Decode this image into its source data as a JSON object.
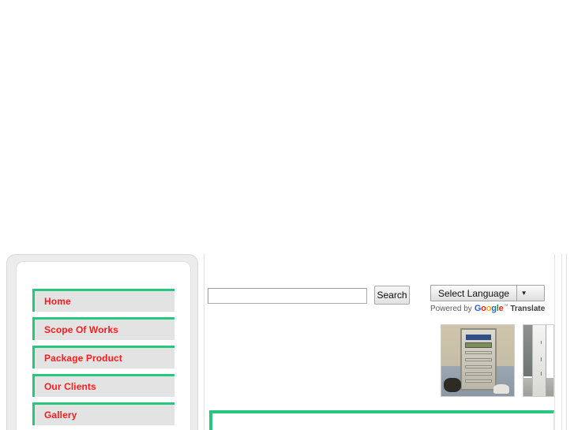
{
  "page": {
    "background_color": "#ffffff",
    "accent_green": "#27c77f",
    "nav_text_color": "#fb1b1b",
    "nav_item_bg": "#e3e3e3"
  },
  "sidebar": {
    "items": [
      {
        "label": "Home"
      },
      {
        "label": "Scope Of Works"
      },
      {
        "label": "Package Product"
      },
      {
        "label": "Our Clients"
      },
      {
        "label": "Gallery"
      }
    ]
  },
  "search": {
    "value": "",
    "placeholder": "",
    "button_label": "Search"
  },
  "translate": {
    "select_label": "Select Language",
    "arrow_glyph": "▼",
    "powered_prefix": "Powered by",
    "google_letters": [
      {
        "char": "G",
        "color": "#2b5fcb"
      },
      {
        "char": "o",
        "color": "#dd2b20"
      },
      {
        "char": "o",
        "color": "#f2b50a"
      },
      {
        "char": "g",
        "color": "#2b5fcb"
      },
      {
        "char": "l",
        "color": "#1d9b42"
      },
      {
        "char": "e",
        "color": "#dd2b20"
      }
    ],
    "trademark": "™",
    "translate_label": "Translate"
  },
  "gallery": {
    "images": [
      {
        "alt": "electrical control panel cabinet in room"
      },
      {
        "alt": "white electrical cabinet doorway"
      }
    ]
  },
  "content_box": {
    "text": ""
  }
}
